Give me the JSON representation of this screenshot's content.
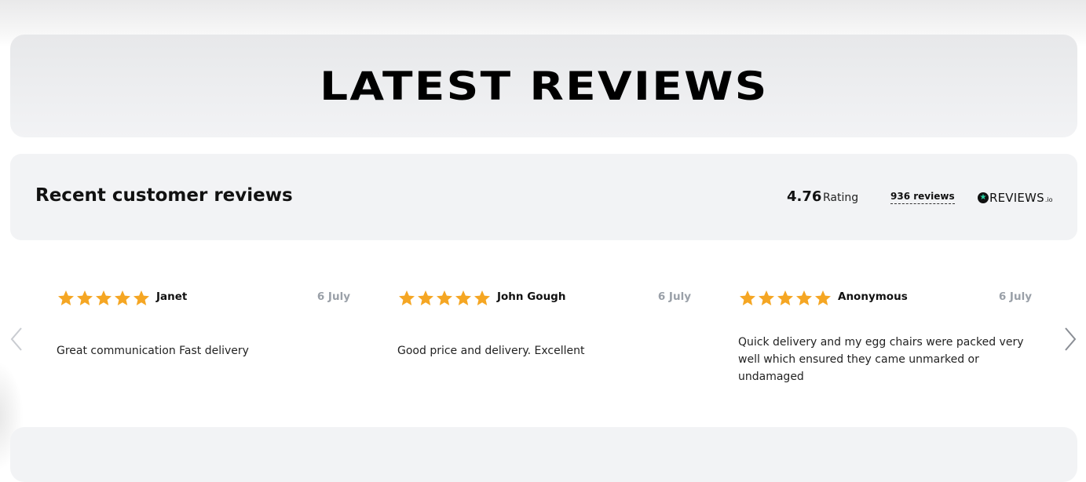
{
  "hero": {
    "title": "LATEST REVIEWS"
  },
  "summary": {
    "title": "Recent customer reviews",
    "rating_value": "4.76",
    "rating_label": "Rating",
    "review_count": "936 reviews",
    "brand": {
      "name": "REVIEWS",
      "suffix": ".io",
      "icon": "star-badge-icon"
    }
  },
  "colors": {
    "star": "#f5a623",
    "date": "#9aa0a8",
    "panel": "#f2f3f5"
  },
  "carousel": {
    "prev_icon": "chevron-left-icon",
    "next_icon": "chevron-right-icon",
    "reviews": [
      {
        "name": "Janet",
        "date": "6 July",
        "rating": 5,
        "text": "Great communication Fast delivery"
      },
      {
        "name": "John Gough",
        "date": "6 July",
        "rating": 5,
        "text": "Good price and delivery. Excellent"
      },
      {
        "name": "Anonymous",
        "date": "6 July",
        "rating": 5,
        "text": "Quick delivery and my egg chairs were packed very well which ensured they came unmarked or undamaged"
      }
    ]
  }
}
